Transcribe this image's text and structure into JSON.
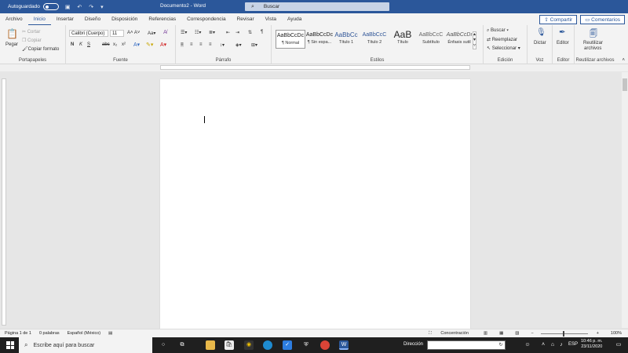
{
  "titlebar": {
    "autosave_label": "Autoguardado",
    "doc_title": "Documento2 - Word",
    "search_placeholder": "Buscar"
  },
  "tabs": [
    "Archivo",
    "Inicio",
    "Insertar",
    "Diseño",
    "Disposición",
    "Referencias",
    "Correspondencia",
    "Revisar",
    "Vista",
    "Ayuda"
  ],
  "actions": {
    "share": "Compartir",
    "comments": "Comentarios"
  },
  "ribbon": {
    "clipboard": {
      "label": "Portapapeles",
      "paste": "Pegar",
      "cut": "Cortar",
      "copy": "Copiar",
      "format_painter": "Copiar formato"
    },
    "font": {
      "label": "Fuente",
      "family": "Calibri (Cuerpo)",
      "size": "11"
    },
    "paragraph": {
      "label": "Párrafo"
    },
    "styles": {
      "label": "Estilos",
      "items": [
        {
          "preview": "AaBbCcDc",
          "name": "¶ Normal"
        },
        {
          "preview": "AaBbCcDc",
          "name": "¶ Sin espa..."
        },
        {
          "preview": "AaBbCc",
          "name": "Título 1"
        },
        {
          "preview": "AaBbCcC",
          "name": "Título 2"
        },
        {
          "preview": "AaB",
          "name": "Título"
        },
        {
          "preview": "AaBbCcC",
          "name": "Subtítulo"
        },
        {
          "preview": "AaBbCcDı",
          "name": "Énfasis sutil"
        }
      ]
    },
    "editing": {
      "label": "Edición",
      "find": "Buscar",
      "replace": "Reemplazar",
      "select": "Seleccionar"
    },
    "voice": {
      "label": "Voz",
      "dictate": "Dictar"
    },
    "editor": {
      "label": "Editor",
      "button": "Editor"
    },
    "reuse": {
      "label": "Reutilizar archivos",
      "button_line1": "Reutilizar",
      "button_line2": "archivos"
    }
  },
  "statusbar": {
    "page": "Página 1 de 1",
    "words": "0 palabras",
    "language": "Español (México)",
    "focus": "Concentración",
    "zoom": "100%"
  },
  "taskbar": {
    "search_placeholder": "Escribe aquí para buscar",
    "address_label": "Dirección",
    "lang": "ESP",
    "time": "10:46 p. m.",
    "date": "23/11/2020"
  }
}
